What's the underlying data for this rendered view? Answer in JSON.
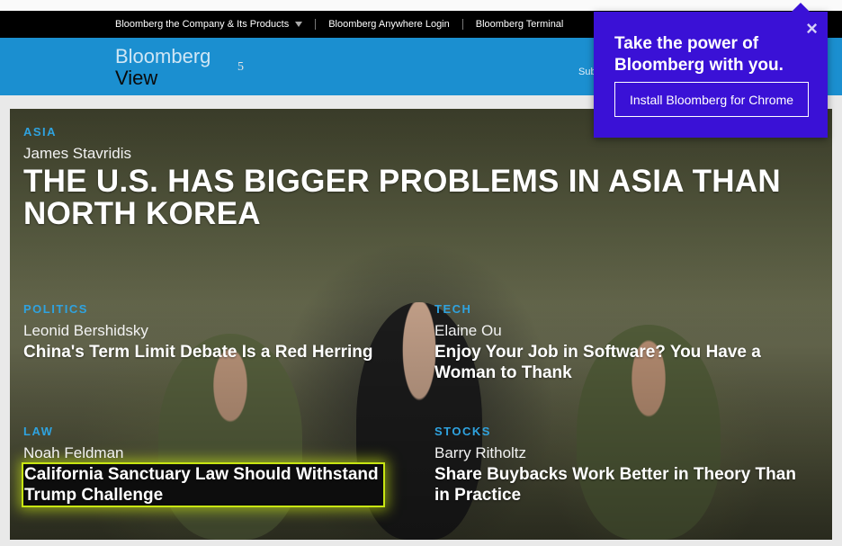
{
  "utility_bar": {
    "items": [
      {
        "label": "Bloomberg the Company & Its Products",
        "has_dropdown": true
      },
      {
        "label": "Bloomberg Anywhere Login",
        "has_dropdown": false
      },
      {
        "label": "Bloomberg Terminal",
        "has_dropdown": false
      }
    ]
  },
  "header": {
    "brand": "Bloomberg",
    "section": "View",
    "notification_count": "5",
    "subscribe": "Sub"
  },
  "hero": {
    "main": {
      "kicker": "ASIA",
      "author": "James Stavridis",
      "headline": "THE U.S. HAS BIGGER PROBLEMS IN ASIA THAN NORTH KOREA"
    },
    "stories": [
      {
        "kicker": "POLITICS",
        "author": "Leonid Bershidsky",
        "headline": "China's Term Limit Debate Is a Red Herring"
      },
      {
        "kicker": "TECH",
        "author": "Elaine Ou",
        "headline": "Enjoy Your Job in Software? You Have a Woman to Thank"
      },
      {
        "kicker": "LAW",
        "author": "Noah Feldman",
        "headline": "California Sanctuary Law Should Withstand Trump Challenge"
      },
      {
        "kicker": "STOCKS",
        "author": "Barry Ritholtz",
        "headline": "Share Buybacks Work Better in Theory Than in Practice"
      }
    ]
  },
  "promo": {
    "title": "Take the power of Bloomberg with you.",
    "button_label": "Install Bloomberg for Chrome",
    "close_icon": "close-icon"
  },
  "colors": {
    "utility_bar": "#000000",
    "header_blue": "#1b8fd0",
    "kicker_blue": "#2fa3e0",
    "promo_purple": "#3a11d6",
    "highlight": "#c8e612"
  }
}
